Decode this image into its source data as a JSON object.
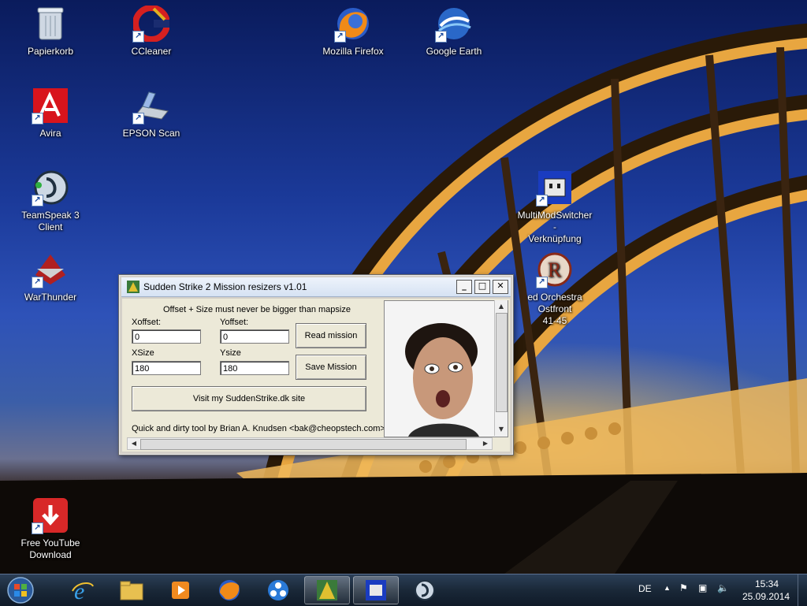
{
  "desktop_icons": [
    {
      "label": "Papierkorb",
      "icon": "recycle-bin-icon"
    },
    {
      "label": "CCleaner",
      "icon": "ccleaner-icon"
    },
    {
      "label": "Mozilla Firefox",
      "icon": "firefox-icon"
    },
    {
      "label": "Google Earth",
      "icon": "google-earth-icon"
    },
    {
      "label": "Avira",
      "icon": "avira-icon"
    },
    {
      "label": "EPSON Scan",
      "icon": "scanner-icon"
    },
    {
      "label": "TeamSpeak 3 Client",
      "icon": "teamspeak-icon"
    },
    {
      "label": "MultiModSwitcher -",
      "label2": "Verknüpfung",
      "icon": "multimodswitcher-icon"
    },
    {
      "label": "WarThunder",
      "icon": "warthunder-icon"
    },
    {
      "label": "ed Orchestra Ostfront",
      "label2": "41-45",
      "icon": "red-orchestra-icon"
    },
    {
      "label": "Free YouTube",
      "label2": "Download",
      "icon": "youtube-download-icon"
    }
  ],
  "dialog": {
    "title": "Sudden Strike 2 Mission resizers v1.01",
    "note": "Offset + Size must never be bigger than mapsize",
    "xoffset_label": "Xoffset:",
    "yoffset_label": "Yoffset:",
    "xoffset_value": "0",
    "yoffset_value": "0",
    "xsize_label": "XSize",
    "ysize_label": "Ysize",
    "xsize_value": "180",
    "ysize_value": "180",
    "read_button": "Read mission",
    "save_button": "Save Mission",
    "visit_button": "Visit my SuddenStrike.dk site",
    "credit": "Quick and dirty tool by Brian A. Knudsen <bak@cheopstech.com>",
    "minimize": "_",
    "maximize": "□",
    "close": "✕"
  },
  "taskbar": {
    "items": [
      "start-orb",
      "internet-explorer",
      "file-explorer",
      "media-player",
      "firefox",
      "app-circles",
      "sudden-strike",
      "multimodswitcher",
      "teamspeak"
    ],
    "active_items": [
      "sudden-strike",
      "multimodswitcher"
    ],
    "language": "DE",
    "time": "15:34",
    "date": "25.09.2014"
  },
  "colors": {
    "title_bar": "#d6e2f3",
    "dialog_bg": "#ece9d8",
    "taskbar": "#1a2838"
  }
}
